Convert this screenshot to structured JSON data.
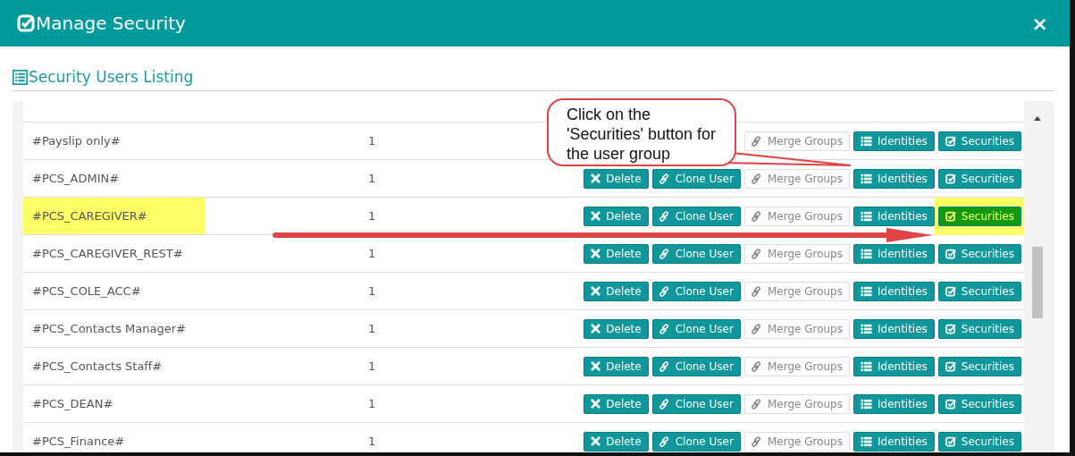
{
  "window": {
    "title": "Manage Security",
    "close": "×"
  },
  "section": {
    "title": "Security Users Listing"
  },
  "rows": [
    {
      "name": "#Payslip only#",
      "count": "1",
      "highlighted": false,
      "buttons": [
        {
          "kind": "merge",
          "label": "Merge Groups"
        },
        {
          "kind": "identities",
          "label": "Identities"
        },
        {
          "kind": "securities",
          "label": "Securities"
        }
      ]
    },
    {
      "name": "#PCS_ADMIN#",
      "count": "1",
      "highlighted": false,
      "buttons": [
        {
          "kind": "delete",
          "label": "Delete"
        },
        {
          "kind": "clone",
          "label": "Clone User"
        },
        {
          "kind": "merge",
          "label": "Merge Groups"
        },
        {
          "kind": "identities",
          "label": "Identities"
        },
        {
          "kind": "securities",
          "label": "Securities"
        }
      ]
    },
    {
      "name": "#PCS_CAREGIVER#",
      "count": "1",
      "highlighted": true,
      "buttons": [
        {
          "kind": "delete",
          "label": "Delete"
        },
        {
          "kind": "clone",
          "label": "Clone User"
        },
        {
          "kind": "merge",
          "label": "Merge Groups"
        },
        {
          "kind": "identities",
          "label": "Identities"
        },
        {
          "kind": "securities",
          "label": "Securities"
        }
      ]
    },
    {
      "name": "#PCS_CAREGIVER_REST#",
      "count": "1",
      "highlighted": false,
      "buttons": [
        {
          "kind": "delete",
          "label": "Delete"
        },
        {
          "kind": "clone",
          "label": "Clone User"
        },
        {
          "kind": "merge",
          "label": "Merge Groups"
        },
        {
          "kind": "identities",
          "label": "Identities"
        },
        {
          "kind": "securities",
          "label": "Securities"
        }
      ]
    },
    {
      "name": "#PCS_COLE_ACC#",
      "count": "1",
      "highlighted": false,
      "buttons": [
        {
          "kind": "delete",
          "label": "Delete"
        },
        {
          "kind": "clone",
          "label": "Clone User"
        },
        {
          "kind": "merge",
          "label": "Merge Groups"
        },
        {
          "kind": "identities",
          "label": "Identities"
        },
        {
          "kind": "securities",
          "label": "Securities"
        }
      ]
    },
    {
      "name": "#PCS_Contacts Manager#",
      "count": "1",
      "highlighted": false,
      "buttons": [
        {
          "kind": "delete",
          "label": "Delete"
        },
        {
          "kind": "clone",
          "label": "Clone User"
        },
        {
          "kind": "merge",
          "label": "Merge Groups"
        },
        {
          "kind": "identities",
          "label": "Identities"
        },
        {
          "kind": "securities",
          "label": "Securities"
        }
      ]
    },
    {
      "name": "#PCS_Contacts Staff#",
      "count": "1",
      "highlighted": false,
      "buttons": [
        {
          "kind": "delete",
          "label": "Delete"
        },
        {
          "kind": "clone",
          "label": "Clone User"
        },
        {
          "kind": "merge",
          "label": "Merge Groups"
        },
        {
          "kind": "identities",
          "label": "Identities"
        },
        {
          "kind": "securities",
          "label": "Securities"
        }
      ]
    },
    {
      "name": "#PCS_DEAN#",
      "count": "1",
      "highlighted": false,
      "buttons": [
        {
          "kind": "delete",
          "label": "Delete"
        },
        {
          "kind": "clone",
          "label": "Clone User"
        },
        {
          "kind": "merge",
          "label": "Merge Groups"
        },
        {
          "kind": "identities",
          "label": "Identities"
        },
        {
          "kind": "securities",
          "label": "Securities"
        }
      ]
    },
    {
      "name": "#PCS_Finance#",
      "count": "1",
      "highlighted": false,
      "buttons": [
        {
          "kind": "delete",
          "label": "Delete"
        },
        {
          "kind": "clone",
          "label": "Clone User"
        },
        {
          "kind": "merge",
          "label": "Merge Groups"
        },
        {
          "kind": "identities",
          "label": "Identities"
        },
        {
          "kind": "securities",
          "label": "Securities"
        }
      ]
    }
  ],
  "callout": {
    "text": "Click on the 'Securities' button for the user group"
  }
}
